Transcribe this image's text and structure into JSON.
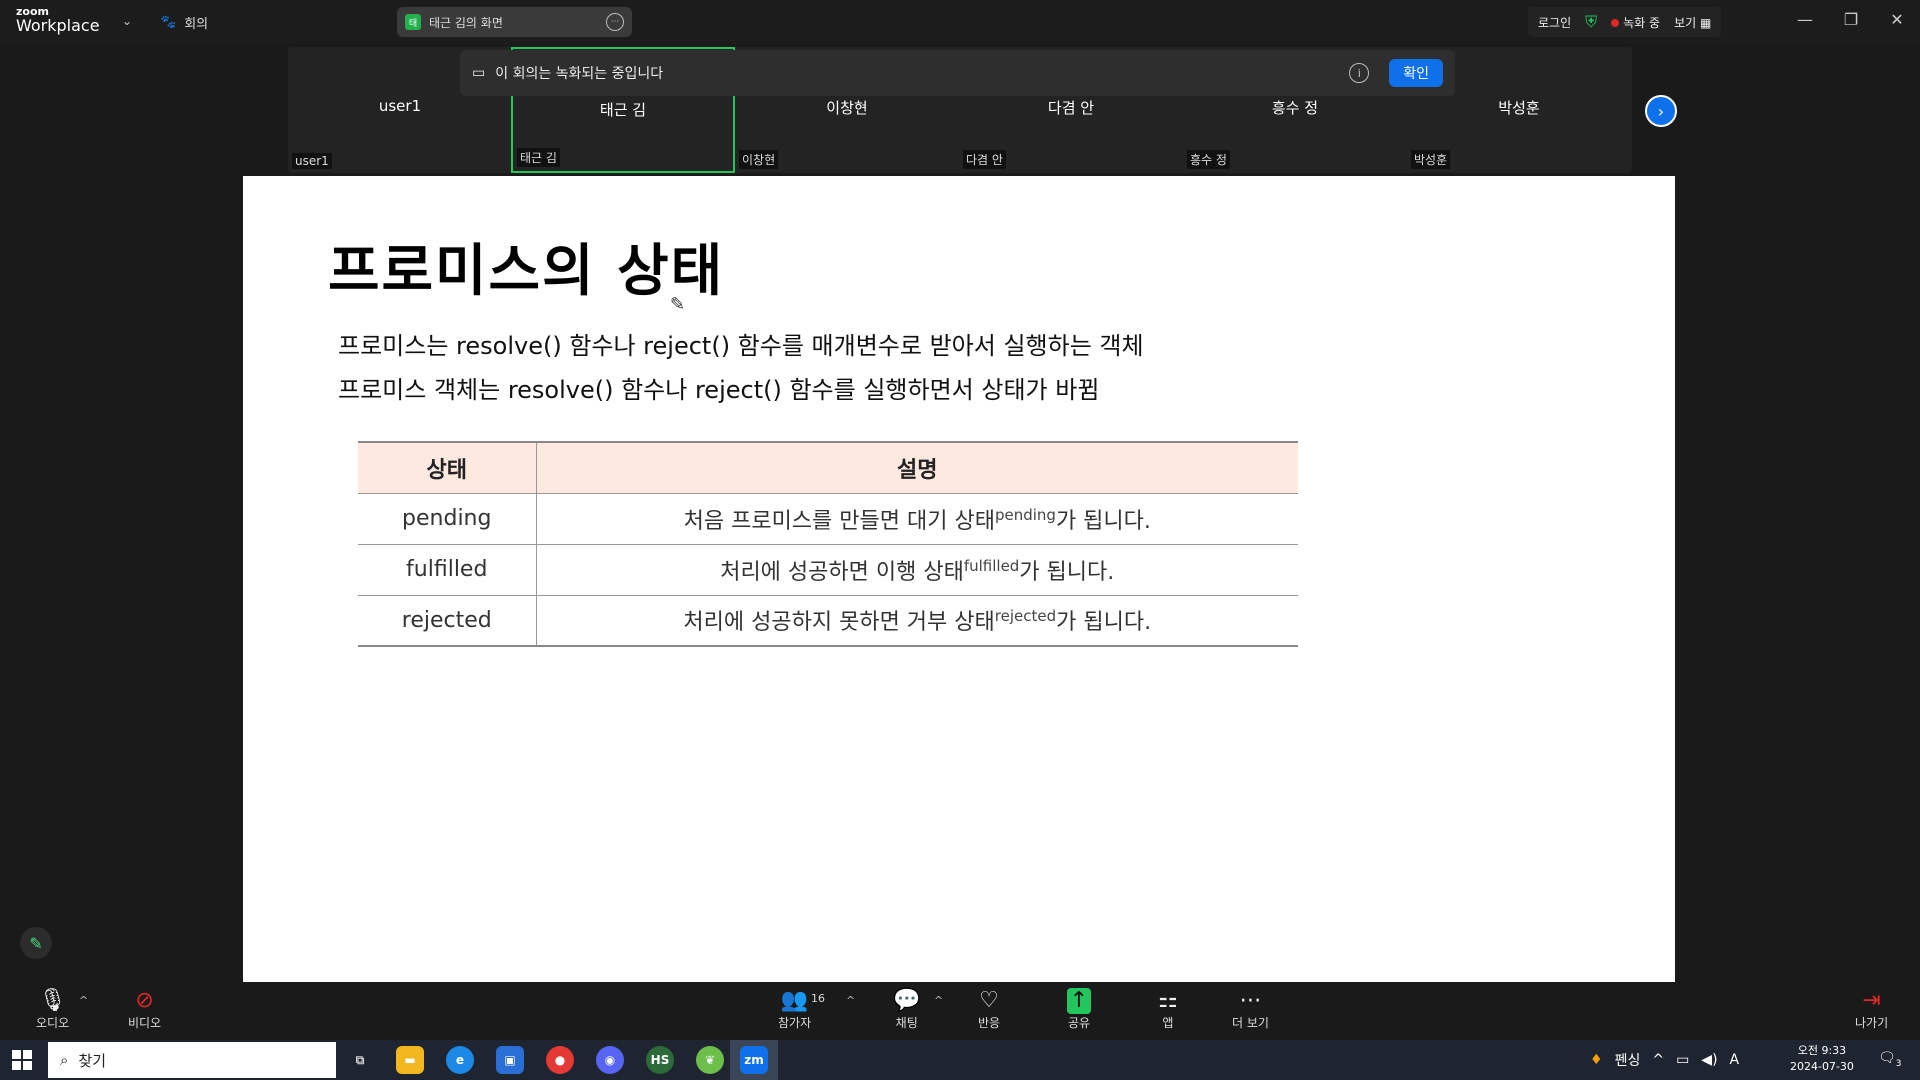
{
  "topbar": {
    "logo_small": "zoom",
    "logo_big": "Workplace",
    "meeting_label": "회의",
    "share_tab_label": "태근 김의 화면",
    "login": "로그인",
    "recording": "녹화 중",
    "view": "보기"
  },
  "gallery": {
    "banner_text": "이 회의는 녹화되는 중입니다",
    "banner_ok": "확인",
    "tiles": [
      {
        "name": "user1",
        "label": "user1"
      },
      {
        "name": "태근 김",
        "label": "태근 김"
      },
      {
        "name": "이창현",
        "label": "이창현"
      },
      {
        "name": "다겸 안",
        "label": "다겸 안"
      },
      {
        "name": "흥수 정",
        "label": "흥수 정"
      },
      {
        "name": "박성훈",
        "label": "박성훈"
      }
    ]
  },
  "slide": {
    "title": "프로미스의 상태",
    "line1": "프로미스는 resolve() 함수나 reject() 함수를 매개변수로 받아서 실행하는 객체",
    "line2": "프로미스 객체는 resolve() 함수나 reject() 함수를 실행하면서 상태가 바뀜",
    "table": {
      "headers": [
        "상태",
        "설명"
      ],
      "rows": [
        {
          "state": "pending",
          "desc_a": "처음 프로미스를 만들면 대기 상태",
          "sup": "pending",
          "desc_b": "가 됩니다."
        },
        {
          "state": "fulfilled",
          "desc_a": "처리에 성공하면 이행 상태",
          "sup": "fulfilled",
          "desc_b": "가 됩니다."
        },
        {
          "state": "rejected",
          "desc_a": "처리에 성공하지 못하면 거부 상태",
          "sup": "rejected",
          "desc_b": "가 됩니다."
        }
      ]
    }
  },
  "controls": {
    "audio": "오디오",
    "video": "비디오",
    "participants": "참가자",
    "participants_count": "16",
    "chat": "채팅",
    "reactions": "반응",
    "share": "공유",
    "apps": "앱",
    "more": "더 보기",
    "leave": "나가기"
  },
  "taskbar": {
    "search_placeholder": "찾기",
    "ime": "펜싱",
    "lang": "A",
    "time": "오전 9:33",
    "date": "2024-07-30",
    "notifications": "3"
  },
  "colors": {
    "accent_blue": "#0e71eb",
    "active_green": "#22c55e",
    "record_red": "#e02828",
    "table_header_bg": "#fde9e0"
  }
}
